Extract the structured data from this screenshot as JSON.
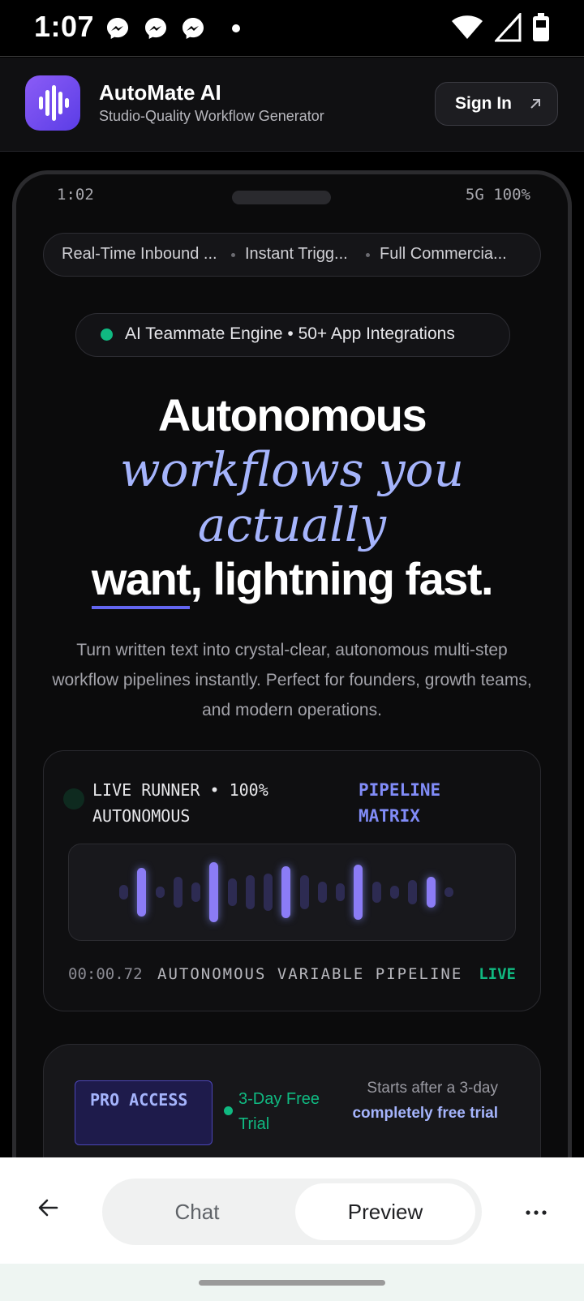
{
  "status_bar": {
    "time": "1:07"
  },
  "header": {
    "app_name": "AutoMate AI",
    "tagline": "Studio-Quality Workflow Generator",
    "sign_in": "Sign In"
  },
  "device": {
    "time": "1:02",
    "network": "5G 100%"
  },
  "ticker": [
    "Real-Time Inbound ...",
    "Instant Trigg...",
    "Full Commercia..."
  ],
  "badge": "AI Teammate Engine • 50+ App Integrations",
  "headline": {
    "line1": "Autonomous",
    "line2": "workflows you",
    "line3": "actually",
    "line4_under": "want",
    "line4_rest": ", lightning fast."
  },
  "description": "Turn written text into crystal-clear, autonomous multi-step workflow pipelines instantly. Perfect for founders, growth teams, and modern operations.",
  "runner": {
    "status": "LIVE RUNNER • 100% AUTONOMOUS",
    "matrix": "PIPELINE MATRIX",
    "timer": "00:00.72",
    "label": "AUTONOMOUS VARIABLE PIPELINE",
    "live": "LIVE"
  },
  "pro": {
    "badge": "PRO ACCESS",
    "trial": "3-Day Free Trial",
    "note_prefix": "Starts after a 3-day",
    "note_emph": "completely free trial"
  },
  "bottom_nav": {
    "chat": "Chat",
    "preview": "Preview"
  },
  "colors": {
    "accent": "#818cf8",
    "accent_light": "#a5b4fc",
    "live_green": "#10b981",
    "background": "#0b0b0c"
  }
}
